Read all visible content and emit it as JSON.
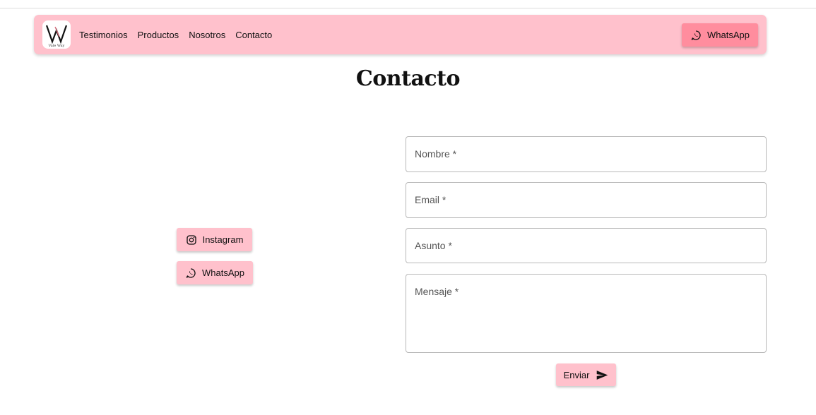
{
  "nav": {
    "logo_text": "Vale Way",
    "links": [
      "Testimonios",
      "Productos",
      "Nosotros",
      "Contacto"
    ],
    "whatsapp_label": "WhatsApp"
  },
  "page": {
    "title": "Contacto"
  },
  "social": {
    "instagram_label": "Instagram",
    "whatsapp_label": "WhatsApp"
  },
  "form": {
    "name_placeholder": "Nombre *",
    "email_placeholder": "Email *",
    "subject_placeholder": "Asunto *",
    "message_placeholder": "Mensaje *",
    "send_label": "Enviar"
  },
  "colors": {
    "navbar_bg": "#ffc1cc",
    "accent_button": "#ff8d9e",
    "button_bg": "#ffc1cc"
  }
}
